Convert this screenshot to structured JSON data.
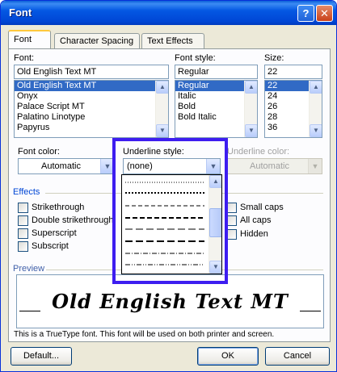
{
  "window": {
    "title": "Font",
    "help_glyph": "?",
    "close_glyph": "✕"
  },
  "tabs": [
    {
      "label": "Font",
      "active": true
    },
    {
      "label": "Character Spacing",
      "active": false
    },
    {
      "label": "Text Effects",
      "active": false
    }
  ],
  "font": {
    "label": "Font:",
    "value": "Old English Text MT",
    "items": [
      "Old English Text MT",
      "Onyx",
      "Palace Script MT",
      "Palatino Linotype",
      "Papyrus"
    ],
    "selected": "Old English Text MT"
  },
  "font_style": {
    "label": "Font style:",
    "value": "Regular",
    "items": [
      "Regular",
      "Italic",
      "Bold",
      "Bold Italic"
    ],
    "selected": "Regular"
  },
  "size": {
    "label": "Size:",
    "value": "22",
    "items": [
      "22",
      "24",
      "26",
      "28",
      "36"
    ],
    "selected": "22"
  },
  "font_color": {
    "label": "Font color:",
    "value": "Automatic"
  },
  "underline_style": {
    "label": "Underline style:",
    "value": "(none)",
    "options": [
      "dotted",
      "dotted-small",
      "dashed",
      "dashed-heavy",
      "long-dash",
      "long-dash-heavy",
      "dash-dot",
      "dash-dot-dot"
    ]
  },
  "underline_color": {
    "label": "Underline color:",
    "value": "Automatic",
    "disabled": true
  },
  "effects": {
    "title": "Effects",
    "left": [
      "Strikethrough",
      "Double strikethrough",
      "Superscript",
      "Subscript"
    ],
    "right": [
      "Small caps",
      "All caps",
      "Hidden"
    ]
  },
  "preview": {
    "title": "Preview",
    "sample": "Old English Text MT",
    "note": "This is a TrueType font. This font will be used on both printer and screen."
  },
  "buttons": {
    "default": "Default...",
    "ok": "OK",
    "cancel": "Cancel"
  },
  "colors": {
    "highlight": "#3d1df0",
    "selection": "#316ac5",
    "titlebar": "#0054e3"
  }
}
